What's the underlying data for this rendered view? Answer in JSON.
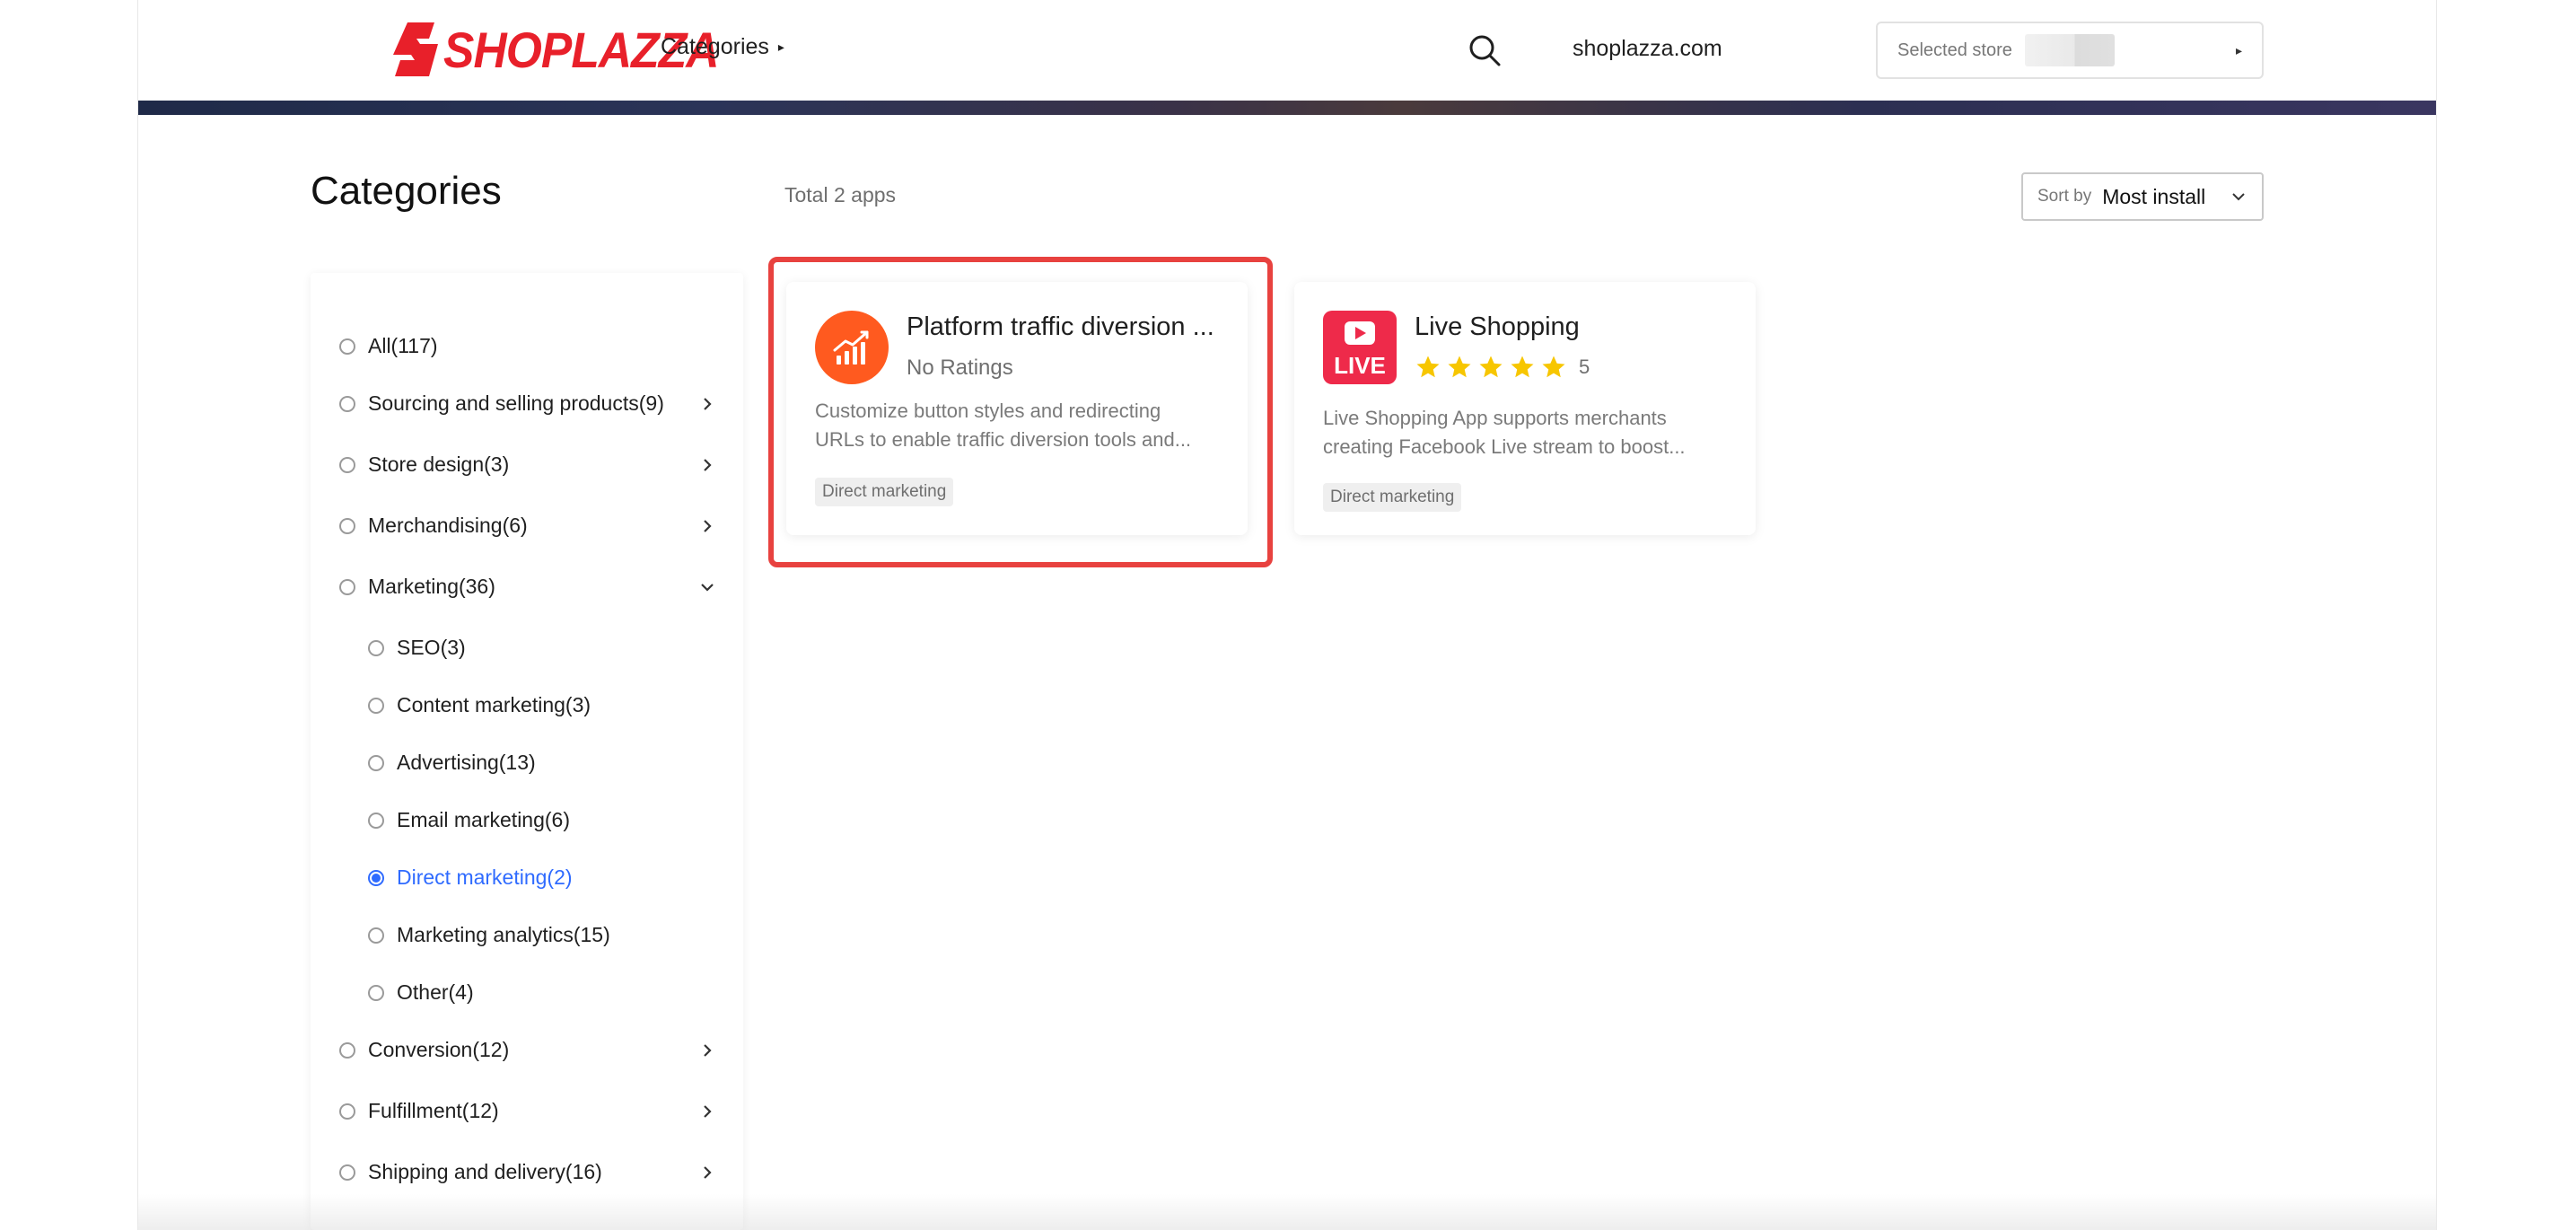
{
  "header": {
    "logo_text": "SHOPLAZZA",
    "nav_categories": "Categories",
    "domain": "shoplazza.com",
    "store_select_label": "Selected store"
  },
  "main": {
    "title": "Categories",
    "total": "Total 2 apps",
    "sort_label": "Sort by",
    "sort_value": "Most install"
  },
  "sidebar": {
    "items": [
      {
        "label": "All(117)"
      },
      {
        "label": "Sourcing and selling products(9)"
      },
      {
        "label": "Store design(3)"
      },
      {
        "label": "Merchandising(6)"
      },
      {
        "label": "Marketing(36)"
      },
      {
        "label": "SEO(3)"
      },
      {
        "label": "Content marketing(3)"
      },
      {
        "label": "Advertising(13)"
      },
      {
        "label": "Email marketing(6)"
      },
      {
        "label": "Direct marketing(2)"
      },
      {
        "label": "Marketing analytics(15)"
      },
      {
        "label": "Other(4)"
      },
      {
        "label": "Conversion(12)"
      },
      {
        "label": "Fulfillment(12)"
      },
      {
        "label": "Shipping and delivery(16)"
      }
    ],
    "selected": "Direct marketing(2)"
  },
  "apps": [
    {
      "title": "Platform traffic diversion ...",
      "rating_text": "No Ratings",
      "description_line1": "Customize button styles and redirecting",
      "description_line2": "URLs to enable traffic diversion tools and...",
      "tag": "Direct marketing",
      "icon": "chart-up-icon"
    },
    {
      "title": "Live Shopping",
      "stars": 5,
      "rating_value": "5",
      "icon_text": "LIVE",
      "description_line1": "Live Shopping App supports merchants",
      "description_line2": "creating Facebook Live stream to boost...",
      "tag": "Direct marketing",
      "icon": "live-play-icon"
    }
  ],
  "colors": {
    "brand": "#e8202a",
    "accent": "#2f6bff",
    "highlight": "#e8423f",
    "star": "#f7c600"
  }
}
